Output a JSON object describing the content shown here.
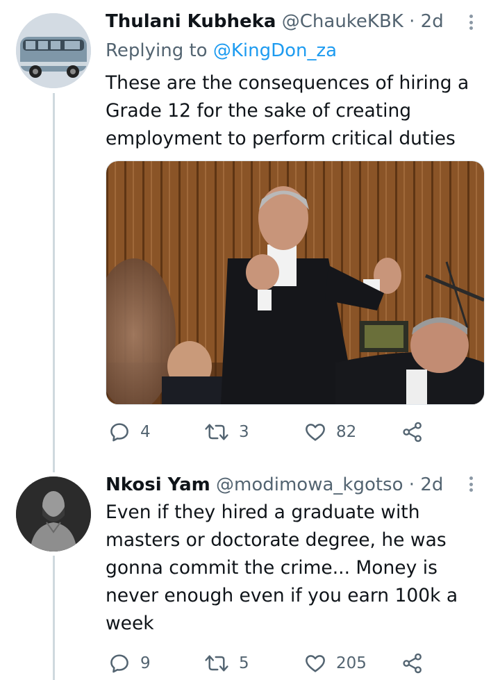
{
  "tweets": [
    {
      "author_name": "Thulani Kubheka",
      "author_handle": "@ChaukeKBK",
      "separator": "·",
      "time": "2d",
      "replying_prefix": "Replying to",
      "replying_to": "@KingDon_za",
      "text": "These are the consequences of hiring a Grade 12 for the sake of creating employment to perform critical duties",
      "avatar_icon": "vw-van-avatar",
      "media_icon": "courtroom-photo",
      "replies": "4",
      "retweets": "3",
      "likes": "82"
    },
    {
      "author_name": "Nkosi Yam",
      "author_handle": "@modimowa_kgotso",
      "separator": "·",
      "time": "2d",
      "text": "Even if they hired a graduate with masters or doctorate degree, he was gonna commit the crime... Money is never enough even if you earn 100k a week",
      "avatar_icon": "man-portrait-avatar",
      "replies": "9",
      "retweets": "5",
      "likes": "205"
    }
  ],
  "colors": {
    "text": "#0f1419",
    "secondary": "#536471",
    "link": "#1d9bf0",
    "thread_line": "#cfd9de"
  }
}
